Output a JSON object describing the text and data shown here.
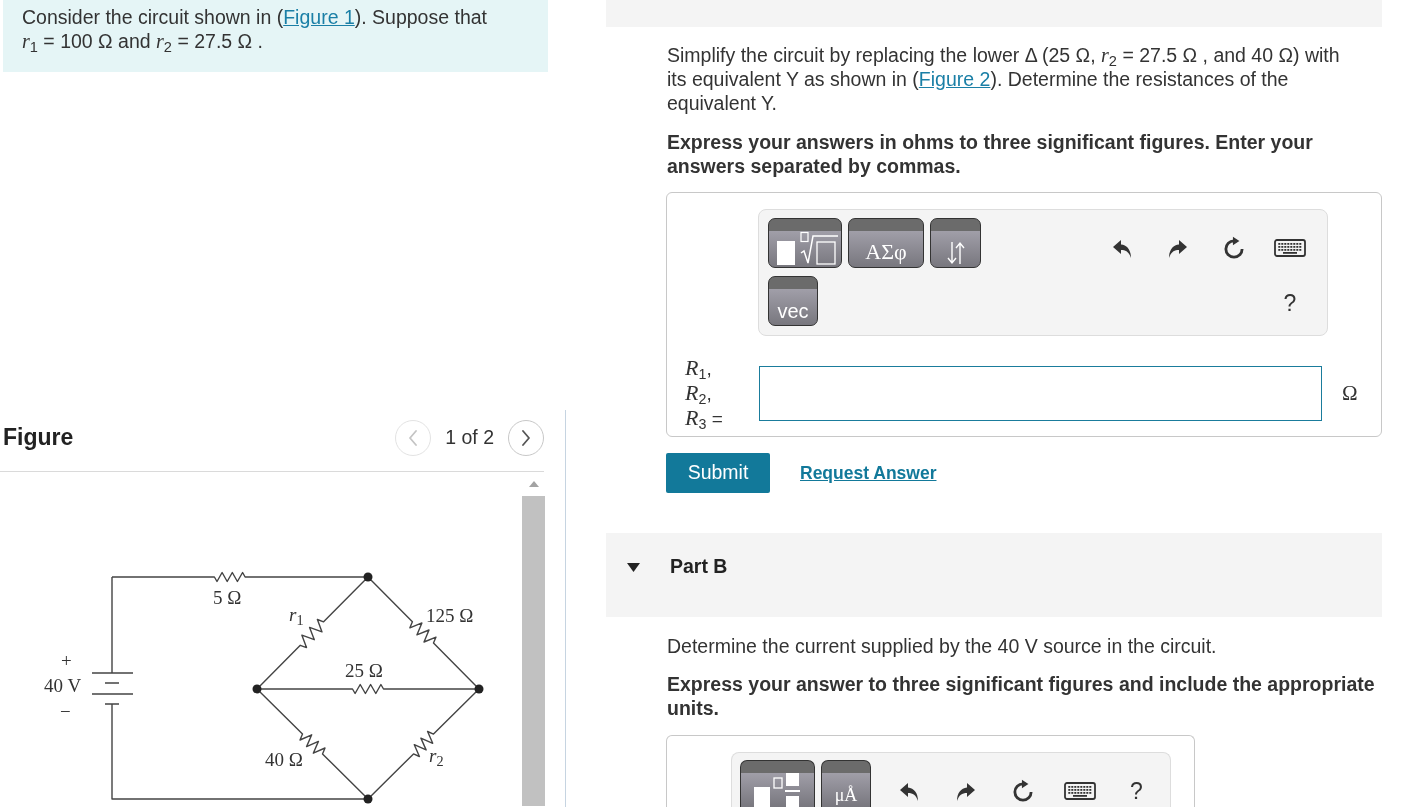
{
  "intro": {
    "text_before": "Consider the circuit shown in (",
    "link": "Figure 1",
    "text_after": "). Suppose that *r*$_{1}$ = 100 Ω and *r*$_{2}$ = 27.5 Ω ."
  },
  "figure_panel": {
    "title": "Figure",
    "pager": {
      "label": "1 of 2",
      "prev_disabled": true,
      "next_disabled": false
    },
    "circuit": {
      "labels": [
        "5 Ω",
        "*r*$_{1}$",
        "125 Ω",
        "+",
        "40 V",
        "−",
        "25 Ω",
        "40 Ω",
        "*r*$_{2}$"
      ]
    }
  },
  "part_a": {
    "prompt_before": "Simplify the circuit by replacing the lower Δ (25 Ω, *r*$_{2}$ = 27.5 Ω , and 40 Ω) with its equivalent Y as shown in (",
    "link": "Figure 2",
    "prompt_after": "). Determine the resistances of the equivalent Y.",
    "instructions": "Express your answers in ohms to three significant figures. Enter your answers separated by commas.",
    "toolbar": {
      "buttons": [
        {
          "kind": "templates"
        },
        {
          "kind": "symbols",
          "label": "ΑΣφ"
        },
        {
          "kind": "arrows"
        },
        {
          "kind": "label",
          "label": "vec"
        }
      ],
      "help": "?"
    },
    "answer": {
      "labels": [
        "*R*$_{1}$,",
        "*R*$_{2}$,",
        "*R*$_{3}$ ="
      ],
      "unit": "Ω"
    },
    "submit": "Submit",
    "request_answer": "Request Answer"
  },
  "part_b": {
    "title": "Part B",
    "expanded": true,
    "prompt": "Determine the current supplied by the 40 V source in the circuit.",
    "instructions": "Express your answer to three significant figures and include the appropriate units.",
    "toolbar": {
      "buttons": [
        {
          "kind": "fraction"
        },
        {
          "kind": "symbols",
          "label": "μÅ"
        }
      ],
      "help": "?"
    }
  }
}
